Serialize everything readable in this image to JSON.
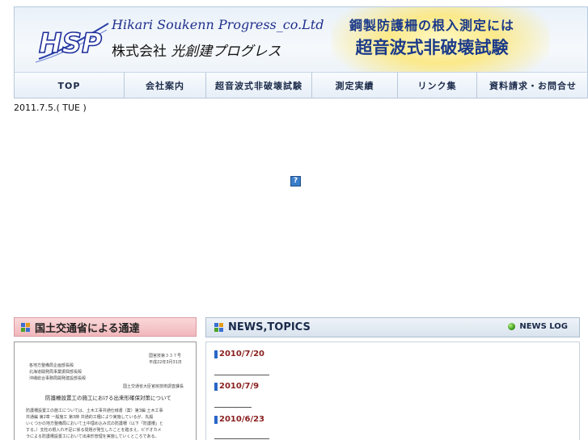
{
  "header": {
    "company_en": "Hikari Soukenn Progress_co.Ltd",
    "company_jp_prefix": "株式会社",
    "company_jp_name": "光創建プログレス",
    "promo_line1": "鋼製防護柵の根入測定には",
    "promo_line2": "超音波式非破壊試験",
    "logo_text": "HSP"
  },
  "nav": {
    "items": [
      {
        "label": "TOP"
      },
      {
        "label": "会社案内"
      },
      {
        "label": "超音波式非破壊試験"
      },
      {
        "label": "測定実績"
      },
      {
        "label": "リンク集"
      },
      {
        "label": "資料請求・お問合せ"
      }
    ]
  },
  "date_line": "2011.7.5.( TUE )",
  "flash_placeholder": "?",
  "left_section": {
    "title": "国土交通省による通達",
    "document": {
      "lines": [
        "国官技第３３７号",
        "平成22年3月31日",
        "各地方整備局企画部長殿",
        "北海道開発局事業振興部長殿",
        "沖縄総合事務局開発建設部長殿",
        "国土交通省大臣官房技術調査課長",
        "防護柵設置工の施工における出来形確保対策について",
        "防護柵設置工の施工については、土木工事共通仕様書（案）第3編 土木工事",
        "共通編 第2章 一般施工 第3節 共通的工種により実施しているが、先般",
        "いくつかの地方整備局において土中埋め込み式の防護柵（以下「防護柵」と",
        "する。）支柱の根入れ不足に係る問題が発生したことを踏まえ、ビデオカメ",
        "ラによる防護柵設置工において出来形管理を実施していくところである。"
      ]
    }
  },
  "news": {
    "title": "NEWS,TOPICS",
    "log_label": "NEWS LOG",
    "items": [
      {
        "date": "2010/7/20"
      },
      {
        "date": "2010/7/9"
      },
      {
        "date": "2010/6/23"
      }
    ]
  },
  "colors": {
    "brand_blue": "#1b3a8a",
    "news_date": "#8a1f1f",
    "mlit_header": "#f1b7bb",
    "bullet_blue": "#2a66c8"
  }
}
